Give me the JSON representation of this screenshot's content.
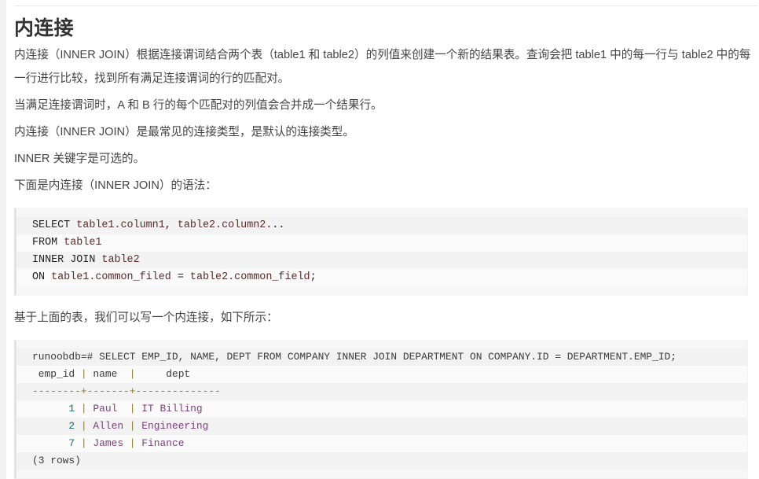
{
  "page": {
    "title": "内连接",
    "accent_code_bg": "#f7f7f7",
    "accent_border": "#e2e2e2",
    "gutter_color": "#f1f1f1"
  },
  "paragraphs": [
    "内连接（INNER JOIN）根据连接谓词结合两个表（table1 和 table2）的列值来创建一个新的结果表。查询会把 table1 中的每一行与 table2 中的每一行进行比较，找到所有满足连接谓词的行的匹配对。",
    "当满足连接谓词时，A 和 B 行的每个匹配对的列值会合并成一个结果行。",
    "内连接（INNER JOIN）是最常见的连接类型，是默认的连接类型。",
    "INNER 关键字是可选的。",
    "下面是内连接（INNER JOIN）的语法："
  ],
  "syntax_block": {
    "lines": [
      [
        {
          "t": "SELECT ",
          "c": "plain"
        },
        {
          "t": "table1.column1",
          "c": "ident"
        },
        {
          "t": ", ",
          "c": "plain"
        },
        {
          "t": "table2.column2",
          "c": "ident"
        },
        {
          "t": "...",
          "c": "plain"
        }
      ],
      [
        {
          "t": "FROM ",
          "c": "plain"
        },
        {
          "t": "table1",
          "c": "ident"
        }
      ],
      [
        {
          "t": "INNER JOIN ",
          "c": "plain"
        },
        {
          "t": "table2",
          "c": "ident"
        }
      ],
      [
        {
          "t": "ON ",
          "c": "plain"
        },
        {
          "t": "table1.common_filed",
          "c": "ident"
        },
        {
          "t": " = ",
          "c": "plain"
        },
        {
          "t": "table2.common_field",
          "c": "ident"
        },
        {
          "t": ";",
          "c": "plain"
        }
      ]
    ]
  },
  "mid_paragraph": "基于上面的表，我们可以写一个内连接，如下所示：",
  "terminal_block": {
    "lines": [
      [
        {
          "t": "runoobdb=# SELECT EMP_ID, NAME, DEPT FROM COMPANY INNER JOIN DEPARTMENT ON COMPANY.ID = DEPARTMENT.EMP_ID;",
          "c": "muted"
        }
      ],
      [
        {
          "t": " emp_id ",
          "c": "muted"
        },
        {
          "t": "|",
          "c": "pipe"
        },
        {
          "t": " name  ",
          "c": "muted"
        },
        {
          "t": "|",
          "c": "pipe"
        },
        {
          "t": "     dept",
          "c": "muted"
        }
      ],
      [
        {
          "t": "--------",
          "c": "dash"
        },
        {
          "t": "+",
          "c": "pipe"
        },
        {
          "t": "-------",
          "c": "dash"
        },
        {
          "t": "+",
          "c": "pipe"
        },
        {
          "t": "--------------",
          "c": "dash"
        }
      ],
      [
        {
          "t": "      1 ",
          "c": "num"
        },
        {
          "t": "|",
          "c": "pipe"
        },
        {
          "t": " Paul  ",
          "c": "str"
        },
        {
          "t": "|",
          "c": "pipe"
        },
        {
          "t": " IT Billing",
          "c": "str"
        }
      ],
      [
        {
          "t": "      2 ",
          "c": "num"
        },
        {
          "t": "|",
          "c": "pipe"
        },
        {
          "t": " Allen ",
          "c": "str"
        },
        {
          "t": "|",
          "c": "pipe"
        },
        {
          "t": " Engineering",
          "c": "str"
        }
      ],
      [
        {
          "t": "      7 ",
          "c": "num"
        },
        {
          "t": "|",
          "c": "pipe"
        },
        {
          "t": " James ",
          "c": "str"
        },
        {
          "t": "|",
          "c": "pipe"
        },
        {
          "t": " Finance",
          "c": "str"
        }
      ],
      [
        {
          "t": "(3 rows)",
          "c": "muted"
        }
      ]
    ]
  }
}
